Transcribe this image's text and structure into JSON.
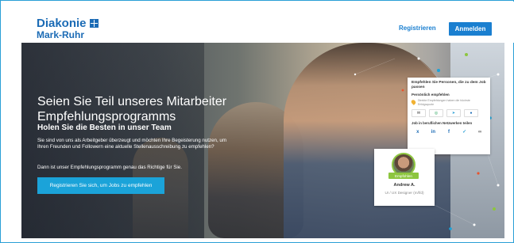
{
  "header": {
    "logo_line1": "Diakonie",
    "logo_line2": "Mark-Ruhr",
    "register_label": "Registrieren",
    "login_label": "Anmelden"
  },
  "hero": {
    "title": "Seien Sie Teil unseres Mitarbeiter Empfehlungsprogramms",
    "subtitle": "Holen Sie die Besten in unser Team",
    "body": "Sie sind von uns als Arbeitgeber überzeugt und möchten Ihre Begeisterung nutzen, um Ihren Freunden und Followern eine aktuelle Stellenausschreibung zu empfehlen?",
    "body2": "Dann ist unser Empfehlungsprogramm genau das Richtige für Sie.",
    "cta_label": "Registrieren Sie sich, um Jobs zu empfehlen"
  },
  "referral_card": {
    "title": "Empfehlen Sie Personen, die zu dem Job passen",
    "section_personal": "Persönlich empfehlen",
    "pin_text": "Direkte Empfehlungen haben die höchste Erfolgsquote",
    "share_icons": [
      "mail-icon",
      "whatsapp-icon",
      "telegram-icon",
      "messenger-icon"
    ],
    "section_networks": "Job in beruflichen Netzwerken teilen",
    "social_icons": [
      "xing-icon",
      "linkedin-icon",
      "facebook-icon",
      "twitter-icon",
      "link-icon"
    ]
  },
  "profile_card": {
    "badge": "Empfohlen",
    "name": "Andrew A.",
    "role": "UI / UX Designer (m/f/d)"
  },
  "colors": {
    "brand": "#1b6bb5",
    "cta": "#1ba3d9",
    "accent_green": "#8dc63f"
  }
}
